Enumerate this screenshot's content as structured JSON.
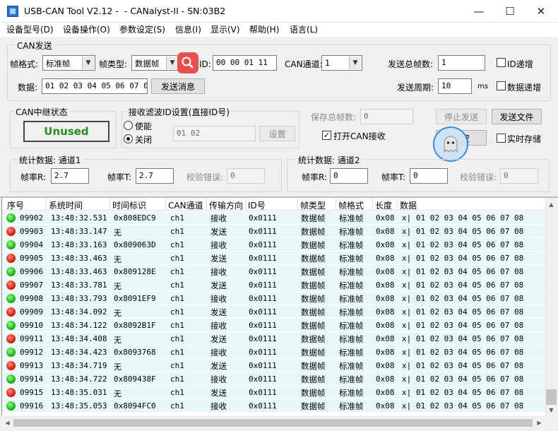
{
  "window": {
    "title": "USB-CAN Tool V2.12 -  - CANalyst-II - SN:03B2",
    "minimize_glyph": "—",
    "maximize_glyph": "☐",
    "close_glyph": "✕"
  },
  "menu": [
    "设备型号(D)",
    "设备操作(O)",
    "参数设定(S)",
    "信息(I)",
    "显示(V)",
    "帮助(H)",
    "语言(L)"
  ],
  "can_send": {
    "legend": "CAN发送",
    "frame_format_label": "帧格式:",
    "frame_format_value": "标准帧",
    "frame_type_label": "帧类型:",
    "frame_type_value": "数据帧",
    "frame_id_label": "帧ID:",
    "frame_id_value": "00 00 01 11",
    "can_channel_label": "CAN通道:",
    "can_channel_value": "1",
    "total_frames_label": "发送总帧数:",
    "total_frames_value": "1",
    "id_increment_label": "ID递增",
    "data_label": "数据:",
    "data_value": "01 02 03 04 05 06 07 08",
    "send_button": "发送消息",
    "send_period_label": "发送周期:",
    "send_period_value": "10",
    "send_period_unit": "ms",
    "data_increment_label": "数据递增"
  },
  "relay": {
    "legend": "CAN中继状态",
    "status": "Unused"
  },
  "filter": {
    "legend": "接收滤波ID设置(直接ID号)",
    "enable_label": "使能",
    "disable_label": "关闭",
    "ids_value": "01 02",
    "set_button": "设置"
  },
  "controls": {
    "saved_frames_label": "保存总帧数:",
    "saved_frames_value": "0",
    "stop_send_button": "停止发送",
    "send_file_button": "发送文件",
    "open_can_receive_label": "打开CAN接收",
    "clear_button": "清空",
    "realtime_save_label": "实时存储"
  },
  "stats1": {
    "legend": "统计数据: 通道1",
    "rx_rate_label": "帧率R:",
    "rx_rate_value": "2.7",
    "tx_rate_label": "帧率T:",
    "tx_rate_value": "2.7",
    "checksum_label": "校验错误:",
    "checksum_value": "0"
  },
  "stats2": {
    "legend": "统计数据: 通道2",
    "rx_rate_label": "帧率R:",
    "rx_rate_value": "0",
    "tx_rate_label": "帧率T:",
    "tx_rate_value": "0",
    "checksum_label": "校验错误:",
    "checksum_value": "0"
  },
  "table": {
    "headers": [
      "序号",
      "系统时间",
      "时间标识",
      "CAN通道",
      "传输方向",
      "ID号",
      "帧类型",
      "帧格式",
      "长度",
      "数据"
    ],
    "rows": [
      {
        "status": "green",
        "seq": "09902",
        "time": "13:48:32.531",
        "stamp": "0x808EDC9",
        "ch": "ch1",
        "dir": "接收",
        "id": "0x0111",
        "type": "数据帧",
        "fmt": "标准帧",
        "len": "0x08",
        "data": "x| 01 02 03 04 05 06 07 08"
      },
      {
        "status": "red",
        "seq": "09903",
        "time": "13:48:33.147",
        "stamp": "无",
        "ch": "ch1",
        "dir": "发送",
        "id": "0x0111",
        "type": "数据帧",
        "fmt": "标准帧",
        "len": "0x08",
        "data": "x| 01 02 03 04 05 06 07 08"
      },
      {
        "status": "green",
        "seq": "09904",
        "time": "13:48:33.163",
        "stamp": "0x809063D",
        "ch": "ch1",
        "dir": "接收",
        "id": "0x0111",
        "type": "数据帧",
        "fmt": "标准帧",
        "len": "0x08",
        "data": "x| 01 02 03 04 05 06 07 08"
      },
      {
        "status": "red",
        "seq": "09905",
        "time": "13:48:33.463",
        "stamp": "无",
        "ch": "ch1",
        "dir": "发送",
        "id": "0x0111",
        "type": "数据帧",
        "fmt": "标准帧",
        "len": "0x08",
        "data": "x| 01 02 03 04 05 06 07 08"
      },
      {
        "status": "green",
        "seq": "09906",
        "time": "13:48:33.463",
        "stamp": "0x809128E",
        "ch": "ch1",
        "dir": "接收",
        "id": "0x0111",
        "type": "数据帧",
        "fmt": "标准帧",
        "len": "0x08",
        "data": "x| 01 02 03 04 05 06 07 08"
      },
      {
        "status": "red",
        "seq": "09907",
        "time": "13:48:33.781",
        "stamp": "无",
        "ch": "ch1",
        "dir": "发送",
        "id": "0x0111",
        "type": "数据帧",
        "fmt": "标准帧",
        "len": "0x08",
        "data": "x| 01 02 03 04 05 06 07 08"
      },
      {
        "status": "green",
        "seq": "09908",
        "time": "13:48:33.793",
        "stamp": "0x8091EF9",
        "ch": "ch1",
        "dir": "接收",
        "id": "0x0111",
        "type": "数据帧",
        "fmt": "标准帧",
        "len": "0x08",
        "data": "x| 01 02 03 04 05 06 07 08"
      },
      {
        "status": "red",
        "seq": "09909",
        "time": "13:48:34.092",
        "stamp": "无",
        "ch": "ch1",
        "dir": "发送",
        "id": "0x0111",
        "type": "数据帧",
        "fmt": "标准帧",
        "len": "0x08",
        "data": "x| 01 02 03 04 05 06 07 08"
      },
      {
        "status": "green",
        "seq": "09910",
        "time": "13:48:34.122",
        "stamp": "0x8092B1F",
        "ch": "ch1",
        "dir": "接收",
        "id": "0x0111",
        "type": "数据帧",
        "fmt": "标准帧",
        "len": "0x08",
        "data": "x| 01 02 03 04 05 06 07 08"
      },
      {
        "status": "red",
        "seq": "09911",
        "time": "13:48:34.408",
        "stamp": "无",
        "ch": "ch1",
        "dir": "发送",
        "id": "0x0111",
        "type": "数据帧",
        "fmt": "标准帧",
        "len": "0x08",
        "data": "x| 01 02 03 04 05 06 07 08"
      },
      {
        "status": "green",
        "seq": "09912",
        "time": "13:48:34.423",
        "stamp": "0x8093768",
        "ch": "ch1",
        "dir": "接收",
        "id": "0x0111",
        "type": "数据帧",
        "fmt": "标准帧",
        "len": "0x08",
        "data": "x| 01 02 03 04 05 06 07 08"
      },
      {
        "status": "red",
        "seq": "09913",
        "time": "13:48:34.719",
        "stamp": "无",
        "ch": "ch1",
        "dir": "发送",
        "id": "0x0111",
        "type": "数据帧",
        "fmt": "标准帧",
        "len": "0x08",
        "data": "x| 01 02 03 04 05 06 07 08"
      },
      {
        "status": "green",
        "seq": "09914",
        "time": "13:48:34.722",
        "stamp": "0x809438F",
        "ch": "ch1",
        "dir": "接收",
        "id": "0x0111",
        "type": "数据帧",
        "fmt": "标准帧",
        "len": "0x08",
        "data": "x| 01 02 03 04 05 06 07 08"
      },
      {
        "status": "red",
        "seq": "09915",
        "time": "13:48:35.031",
        "stamp": "无",
        "ch": "ch1",
        "dir": "发送",
        "id": "0x0111",
        "type": "数据帧",
        "fmt": "标准帧",
        "len": "0x08",
        "data": "x| 01 02 03 04 05 06 07 08"
      },
      {
        "status": "green",
        "seq": "09916",
        "time": "13:48:35.053",
        "stamp": "0x8094FC0",
        "ch": "ch1",
        "dir": "接收",
        "id": "0x0111",
        "type": "数据帧",
        "fmt": "标准帧",
        "len": "0x08",
        "data": "x| 01 02 03 04 05 06 07 08"
      }
    ]
  },
  "colors": {
    "accent_green": "#2a8a24",
    "row_background": "#e8f8f6",
    "search_badge": "#e8504f"
  },
  "icons": [
    "app-icon",
    "search-icon",
    "ghost-assistant-icon"
  ]
}
